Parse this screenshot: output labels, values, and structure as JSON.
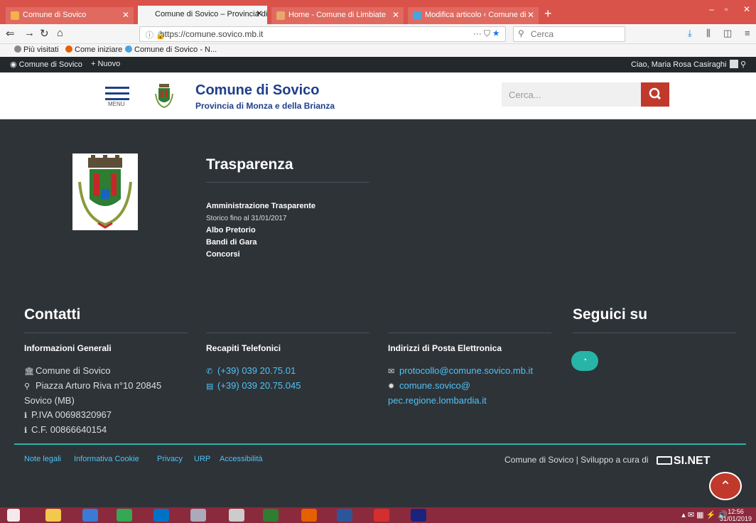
{
  "browser": {
    "tabs": [
      {
        "title": "Comune di Sovico",
        "close": "✕",
        "fav": "#f3b24a"
      },
      {
        "title": "Comune di Sovico – Provincia di M",
        "close": "✕",
        "fav": ""
      },
      {
        "title": "Home - Comune di Limbiate",
        "close": "✕",
        "fav": "#e8a86b"
      },
      {
        "title": "Modifica articolo ‹ Comune di",
        "close": "✕",
        "fav": "#4aa3df"
      }
    ],
    "new_tab": "+",
    "window_controls": {
      "minimize": "–",
      "maximize": "▫",
      "close": "✕"
    },
    "url": "https://comune.sovico.mb.it",
    "url_actions": "···  ☆",
    "search_placeholder": "Cerca",
    "bookmarks": [
      {
        "label": "Più visitati",
        "color": "#888"
      },
      {
        "label": "Come iniziare",
        "color": "#e66000"
      },
      {
        "label": "Comune di Sovico - N...",
        "color": "#4aa3df"
      }
    ]
  },
  "adminbar": {
    "site": "Comune di Sovico",
    "new": "Nuovo",
    "greeting": "Ciao, Maria Rosa Casiraghi"
  },
  "header": {
    "menu_label": "MENU",
    "title": "Comune di Sovico",
    "subtitle": "Provincia di Monza e della Brianza",
    "search_placeholder": "Cerca..."
  },
  "trasparenza": {
    "heading": "Trasparenza",
    "links": [
      {
        "label": "Amministrazione Trasparente",
        "note": "Storico fino al 31/01/2017"
      },
      {
        "label": "Albo Pretorio",
        "note": ""
      },
      {
        "label": "Bandi di Gara",
        "note": ""
      },
      {
        "label": "Concorsi",
        "note": ""
      }
    ]
  },
  "contatti": {
    "heading": "Contatti",
    "social_heading": "Seguici su",
    "col1": {
      "title": "Informazioni Generali",
      "lines": [
        "Comune di Sovico",
        "Piazza Arturo Riva n°10 20845",
        "Sovico (MB)",
        "P.IVA 00698320967",
        "C.F. 00866640154"
      ]
    },
    "col2": {
      "title": "Recapiti Telefonici",
      "phone": "(+39) 039 20.75.01",
      "fax": "(+39) 039 20.75.045"
    },
    "col3": {
      "title": "Indirizzi di Posta Elettronica",
      "email": "protocollo@comune.sovico.mb.it",
      "pec1": "comune.sovico@",
      "pec2": "pec.regione.lombardia.it"
    }
  },
  "footer": {
    "links": [
      "Note legali",
      "Informativa Cookie",
      "Privacy",
      "URP",
      "Accessibilità"
    ],
    "credit": "Comune di Sovico | Sviluppo a cura di",
    "brand": "SI.NET"
  },
  "taskbar": {
    "time": "12:56",
    "date": "31/01/2019"
  }
}
